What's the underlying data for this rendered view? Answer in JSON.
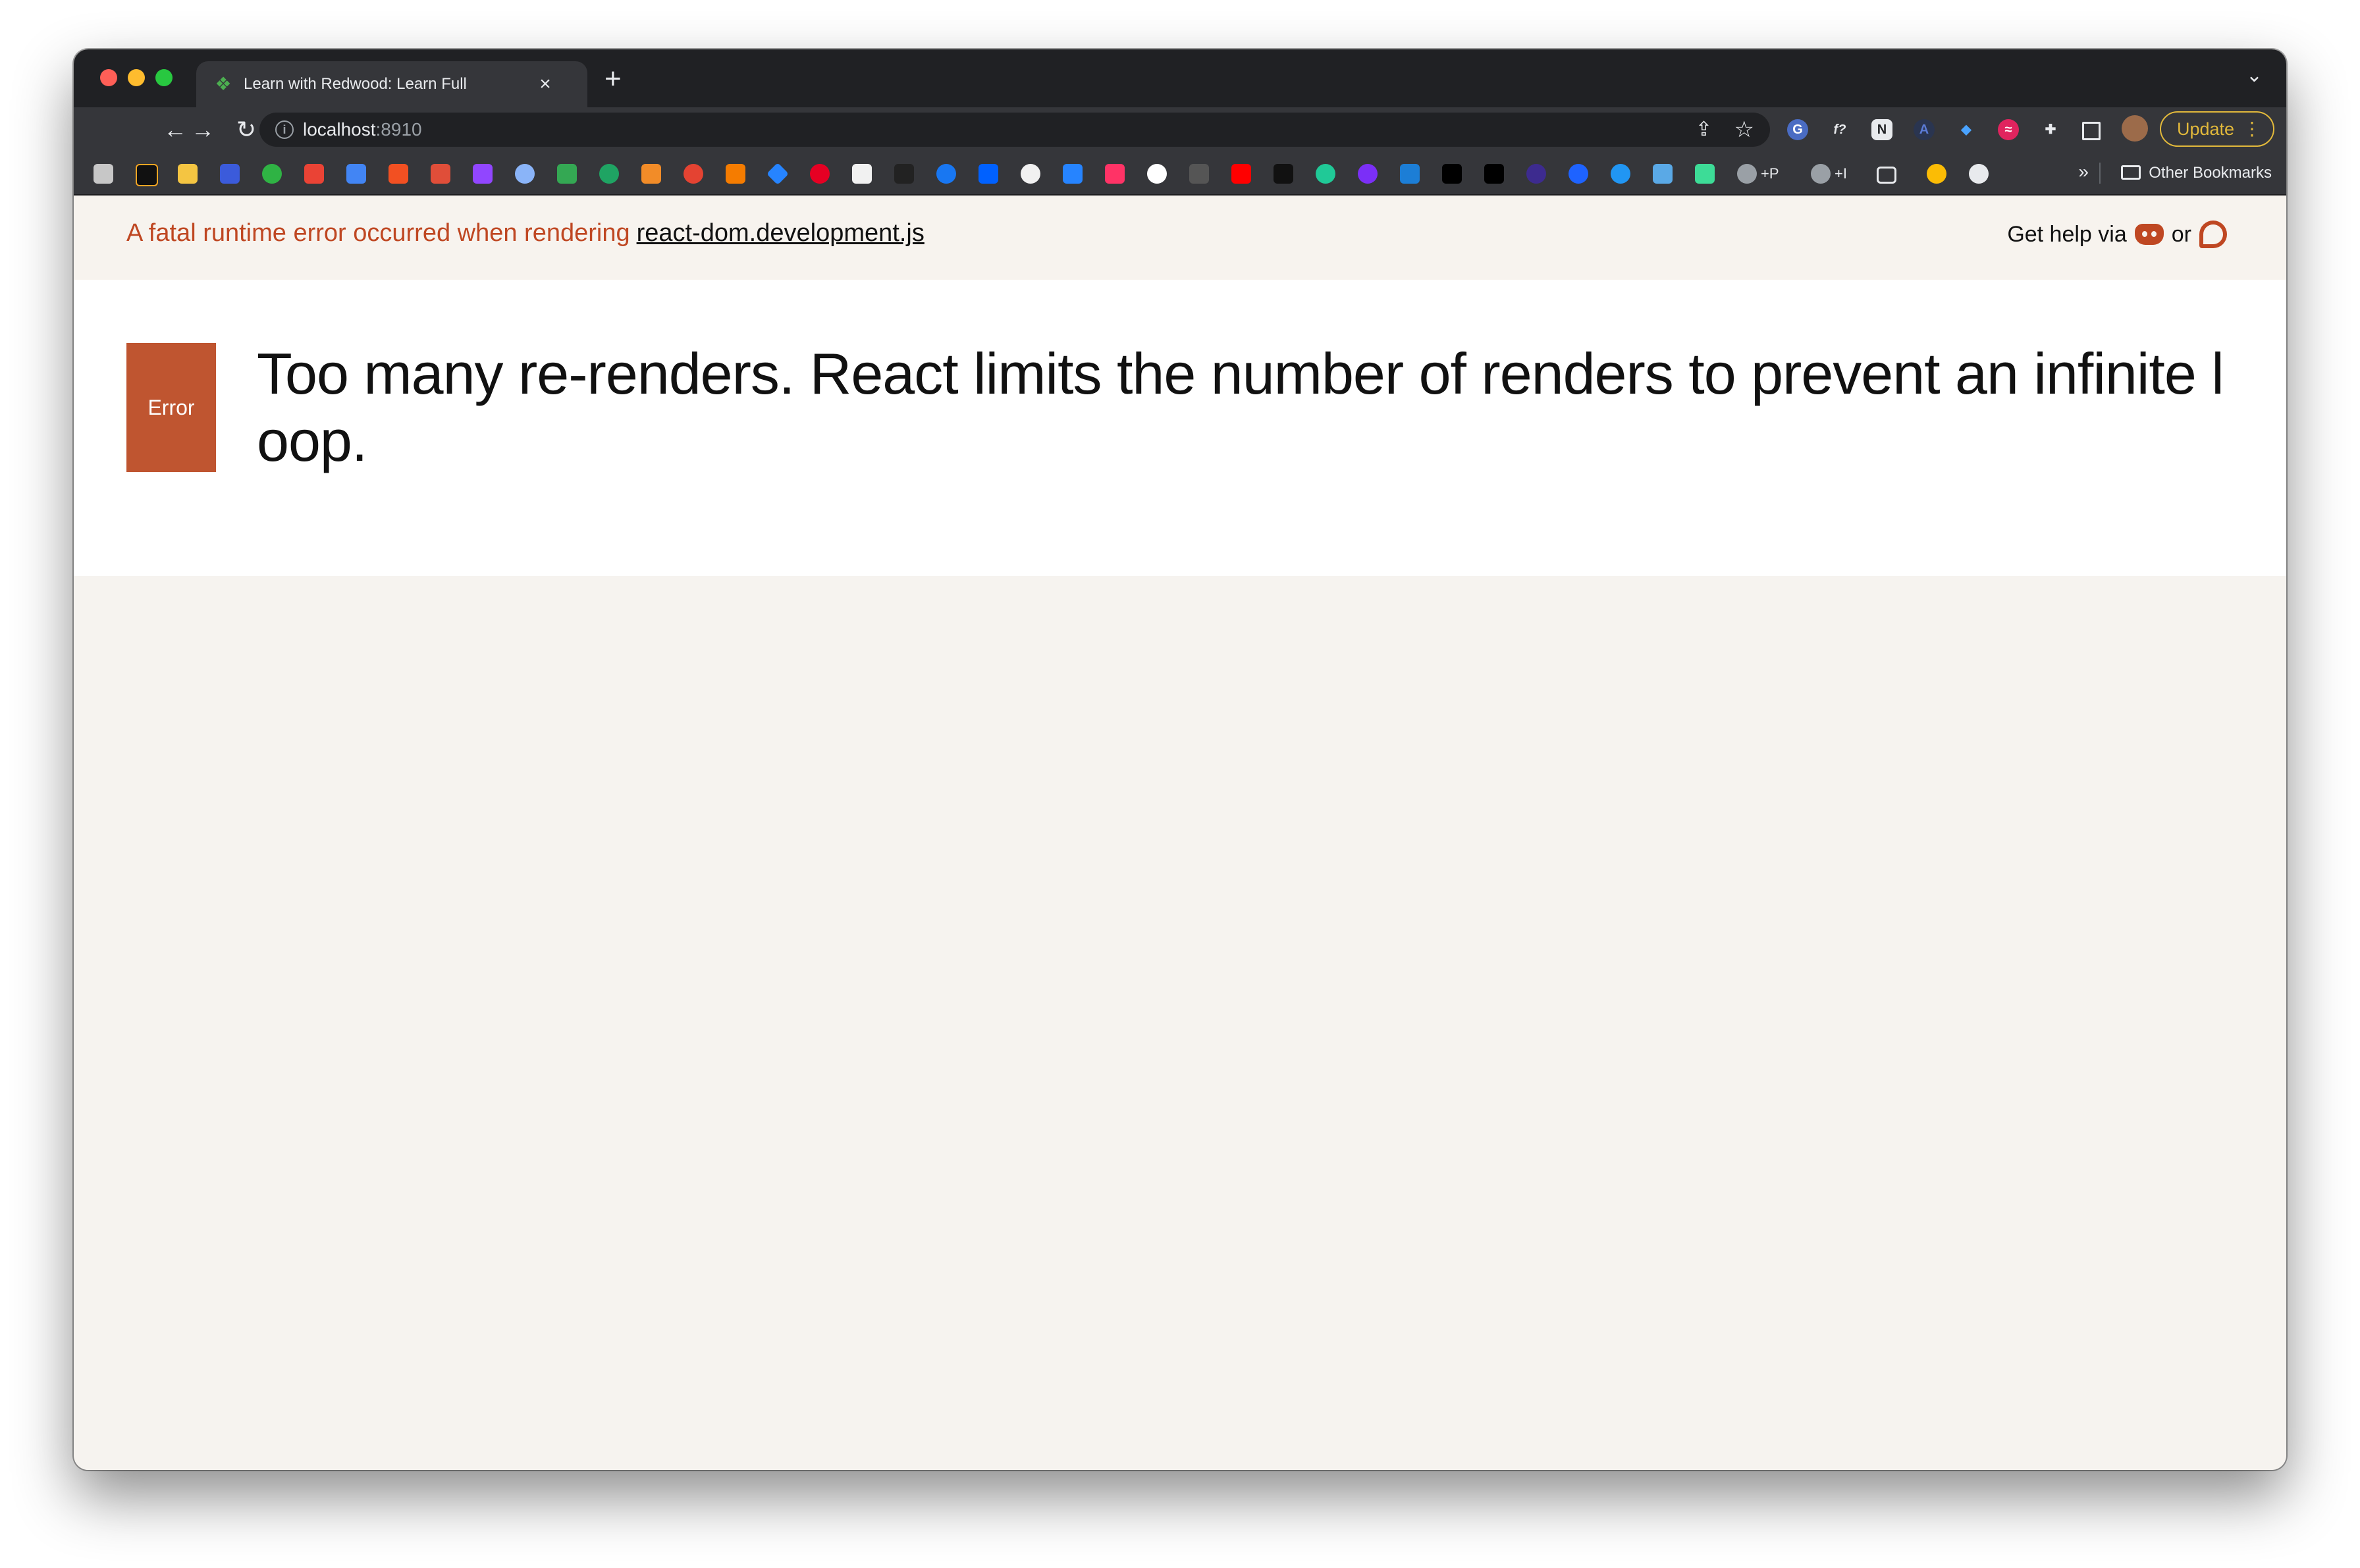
{
  "browser": {
    "tab_title": "Learn with Redwood: Learn Full",
    "new_tab": "+",
    "tab_close": "×",
    "url_host": "localhost",
    "url_port": ":8910",
    "update_label": "Update",
    "other_bookmarks": "Other Bookmarks",
    "bookmark_more": "»",
    "bookmark_plus_p": "+P",
    "bookmark_plus_i": "+I"
  },
  "error_page": {
    "fatal_text": "A fatal runtime error occurred when rendering",
    "fatal_file": "react-dom.development.js",
    "help_text": "Get help via",
    "help_or": "or",
    "badge_label": "Error",
    "message": "Too many re-renders. React limits the number of renders to prevent an infinite loop."
  },
  "colors": {
    "accent": "#bf4722",
    "badge": "#bf5530",
    "page_background": "#f6f3ef",
    "chrome_dark": "#202124"
  }
}
